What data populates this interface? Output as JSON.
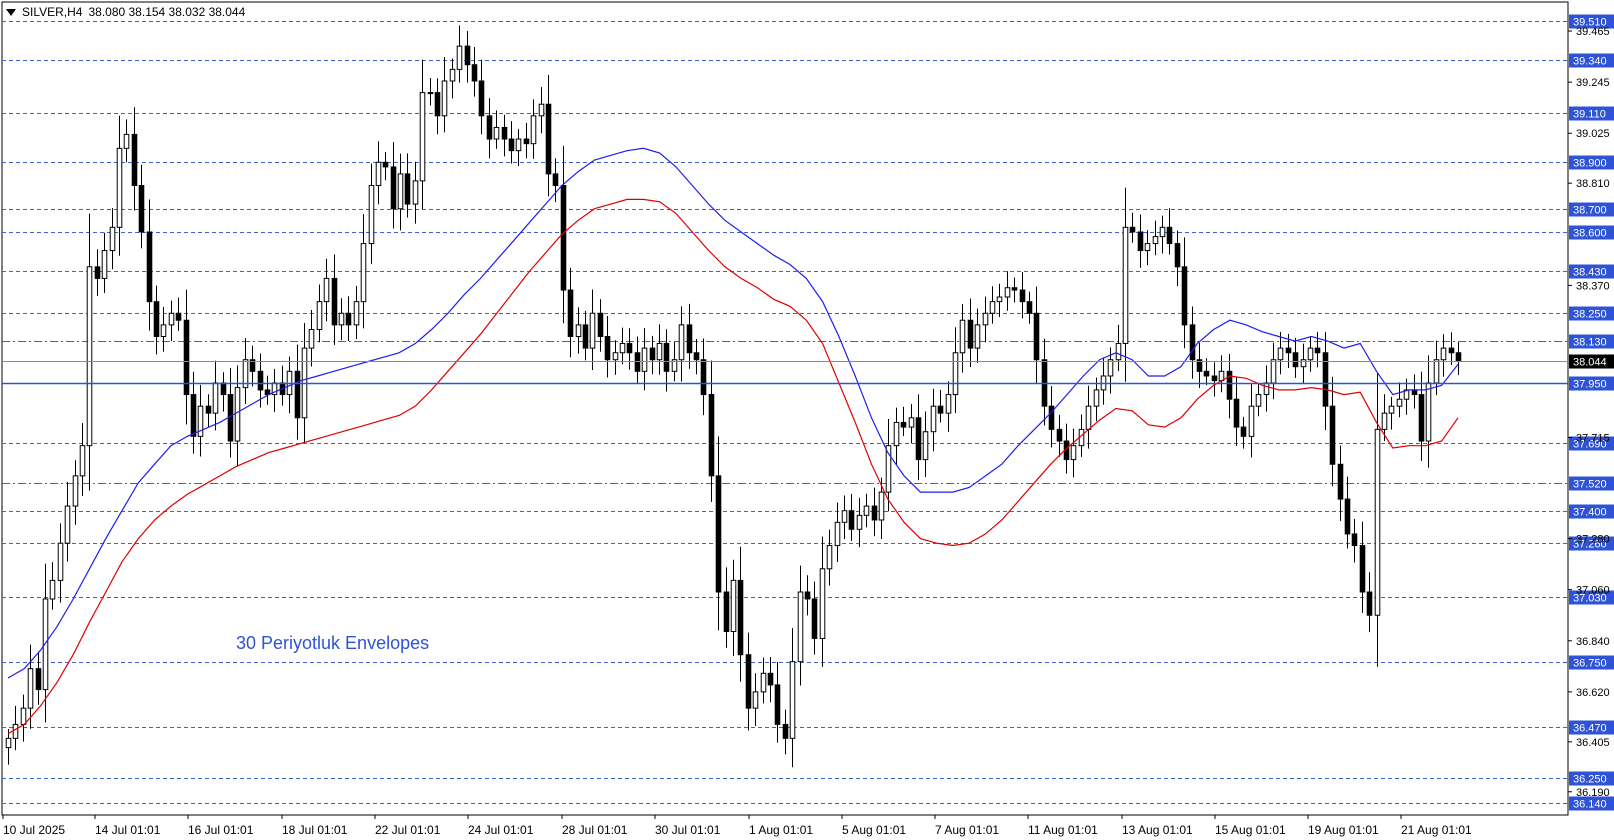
{
  "header": {
    "symbol": "SILVER,H4",
    "ohlc": "38.080 38.154 38.032 38.044"
  },
  "annotation": "30 Periyotluk Envelopes",
  "colors": {
    "background": "#ffffff",
    "grid_dashed": "#3a64c8",
    "upper_envelope": "#1e1ef0",
    "lower_envelope": "#e00000",
    "price_line": "#8a8a8a",
    "resistance_line": "#2f53d6",
    "label_bg": "#2f53d6"
  },
  "chart_data": {
    "type": "candlestick",
    "symbol": "SILVER",
    "timeframe": "H4",
    "ylim": [
      36.09,
      39.59
    ],
    "grid": true,
    "x_ticks": [
      "10 Jul 2025",
      "14 Jul 01:01",
      "16 Jul 01:01",
      "18 Jul 01:01",
      "22 Jul 01:01",
      "24 Jul 01:01",
      "28 Jul 01:01",
      "30 Jul 01:01",
      "1 Aug 01:01",
      "5 Aug 01:01",
      "7 Aug 01:01",
      "11 Aug 01:01",
      "13 Aug 01:01",
      "15 Aug 01:01",
      "19 Aug 01:01",
      "21 Aug 01:01"
    ],
    "y_ticks": [
      "39.465",
      "39.245",
      "39.025",
      "38.810",
      "38.370",
      "37.715",
      "37.280",
      "37.060",
      "36.840",
      "36.620",
      "36.405",
      "36.190"
    ],
    "level_lines": [
      "39.510",
      "39.340",
      "39.110",
      "38.900",
      "38.700",
      "38.600",
      "38.430",
      "38.250",
      "38.130",
      "37.690",
      "37.520",
      "37.400",
      "37.260",
      "37.030",
      "36.750",
      "36.470",
      "36.250",
      "36.140"
    ],
    "dashdot_levels": [
      "38.130",
      "37.520"
    ],
    "resistance_level": "37.950",
    "current_price": "38.044",
    "closes": [
      36.42,
      36.48,
      36.55,
      36.72,
      36.63,
      37.02,
      37.1,
      37.26,
      37.42,
      37.55,
      37.68,
      38.45,
      38.4,
      38.52,
      38.62,
      38.96,
      39.02,
      38.8,
      38.6,
      38.3,
      38.15,
      38.2,
      38.25,
      38.22,
      37.9,
      37.72,
      37.85,
      37.82,
      37.95,
      37.9,
      37.7,
      37.93,
      38.05,
      38.0,
      37.92,
      37.9,
      37.95,
      37.9,
      38.0,
      37.8,
      38.1,
      38.18,
      38.3,
      38.4,
      38.2,
      38.25,
      38.2,
      38.3,
      38.55,
      38.8,
      38.9,
      38.88,
      38.7,
      38.85,
      38.72,
      38.82,
      39.2,
      39.2,
      39.1,
      39.25,
      39.3,
      39.4,
      39.32,
      39.25,
      39.1,
      39.0,
      39.05,
      39.0,
      38.95,
      39.0,
      38.98,
      39.1,
      39.15,
      38.85,
      38.8,
      38.35,
      38.15,
      38.2,
      38.1,
      38.25,
      38.15,
      38.05,
      38.08,
      38.12,
      38.08,
      38.0,
      38.1,
      38.05,
      38.12,
      38.0,
      38.05,
      38.2,
      38.08,
      38.05,
      37.9,
      37.55,
      37.05,
      36.88,
      37.1,
      36.78,
      36.55,
      36.62,
      36.7,
      36.65,
      36.48,
      36.42,
      36.75,
      37.05,
      37.02,
      36.85,
      37.15,
      37.25,
      37.35,
      37.4,
      37.32,
      37.38,
      37.42,
      37.36,
      37.48,
      37.68,
      37.78,
      37.76,
      37.8,
      37.62,
      37.74,
      37.85,
      37.82,
      37.9,
      38.08,
      38.22,
      38.1,
      38.2,
      38.25,
      38.3,
      38.32,
      38.36,
      38.35,
      38.3,
      38.25,
      38.05,
      37.85,
      37.75,
      37.7,
      37.62,
      37.68,
      37.75,
      37.85,
      37.92,
      37.98,
      38.05,
      38.12,
      38.62,
      38.6,
      38.52,
      38.55,
      38.58,
      38.62,
      38.55,
      38.45,
      38.2,
      38.05,
      38.0,
      37.98,
      37.96,
      38.0,
      37.88,
      37.76,
      37.72,
      37.85,
      37.9,
      37.95,
      38.05,
      38.1,
      38.08,
      38.02,
      38.05,
      38.1,
      38.08,
      37.85,
      37.6,
      37.45,
      37.3,
      37.25,
      37.05,
      36.95,
      37.75,
      37.82,
      37.85,
      37.88,
      37.92,
      37.9,
      37.7,
      37.95,
      38.05,
      38.1,
      38.08,
      38.044
    ],
    "series": [
      {
        "name": "",
        "type": "line",
        "color": "#1e1ef0",
        "values": [
          36.68,
          36.72,
          36.8,
          36.9,
          37.02,
          37.15,
          37.28,
          37.4,
          37.52,
          37.6,
          37.68,
          37.72,
          37.75,
          37.78,
          37.82,
          37.86,
          37.9,
          37.93,
          37.96,
          37.98,
          38.0,
          38.02,
          38.04,
          38.06,
          38.08,
          38.12,
          38.18,
          38.25,
          38.33,
          38.4,
          38.48,
          38.56,
          38.64,
          38.72,
          38.8,
          38.86,
          38.91,
          38.93,
          38.95,
          38.96,
          38.94,
          38.88,
          38.8,
          38.72,
          38.65,
          38.6,
          38.55,
          38.5,
          38.46,
          38.4,
          38.3,
          38.15,
          37.98,
          37.8,
          37.65,
          37.55,
          37.48,
          37.48,
          37.48,
          37.5,
          37.55,
          37.6,
          37.68,
          37.75,
          37.82,
          37.9,
          37.98,
          38.05,
          38.08,
          38.05,
          37.98,
          37.98,
          38.02,
          38.12,
          38.18,
          38.22,
          38.2,
          38.17,
          38.15,
          38.13,
          38.15,
          38.13,
          38.1,
          38.12,
          38.0,
          37.9,
          37.92,
          37.92,
          37.94,
          38.03
        ]
      },
      {
        "name": "",
        "type": "line",
        "color": "#e00000",
        "values": [
          36.44,
          36.48,
          36.56,
          36.66,
          36.78,
          36.92,
          37.05,
          37.18,
          37.28,
          37.36,
          37.42,
          37.47,
          37.51,
          37.55,
          37.59,
          37.62,
          37.65,
          37.67,
          37.69,
          37.71,
          37.73,
          37.75,
          37.77,
          37.79,
          37.81,
          37.85,
          37.92,
          38.0,
          38.08,
          38.16,
          38.25,
          38.34,
          38.43,
          38.51,
          38.59,
          38.65,
          38.7,
          38.72,
          38.74,
          38.74,
          38.73,
          38.68,
          38.6,
          38.52,
          38.45,
          38.4,
          38.36,
          38.31,
          38.28,
          38.22,
          38.12,
          37.95,
          37.78,
          37.6,
          37.45,
          37.35,
          37.28,
          37.26,
          37.25,
          37.26,
          37.3,
          37.36,
          37.44,
          37.52,
          37.6,
          37.67,
          37.73,
          37.79,
          37.84,
          37.83,
          37.77,
          37.76,
          37.8,
          37.88,
          37.94,
          37.98,
          37.97,
          37.94,
          37.92,
          37.92,
          37.93,
          37.92,
          37.9,
          37.91,
          37.78,
          37.67,
          37.68,
          37.68,
          37.7,
          37.8
        ]
      }
    ]
  }
}
